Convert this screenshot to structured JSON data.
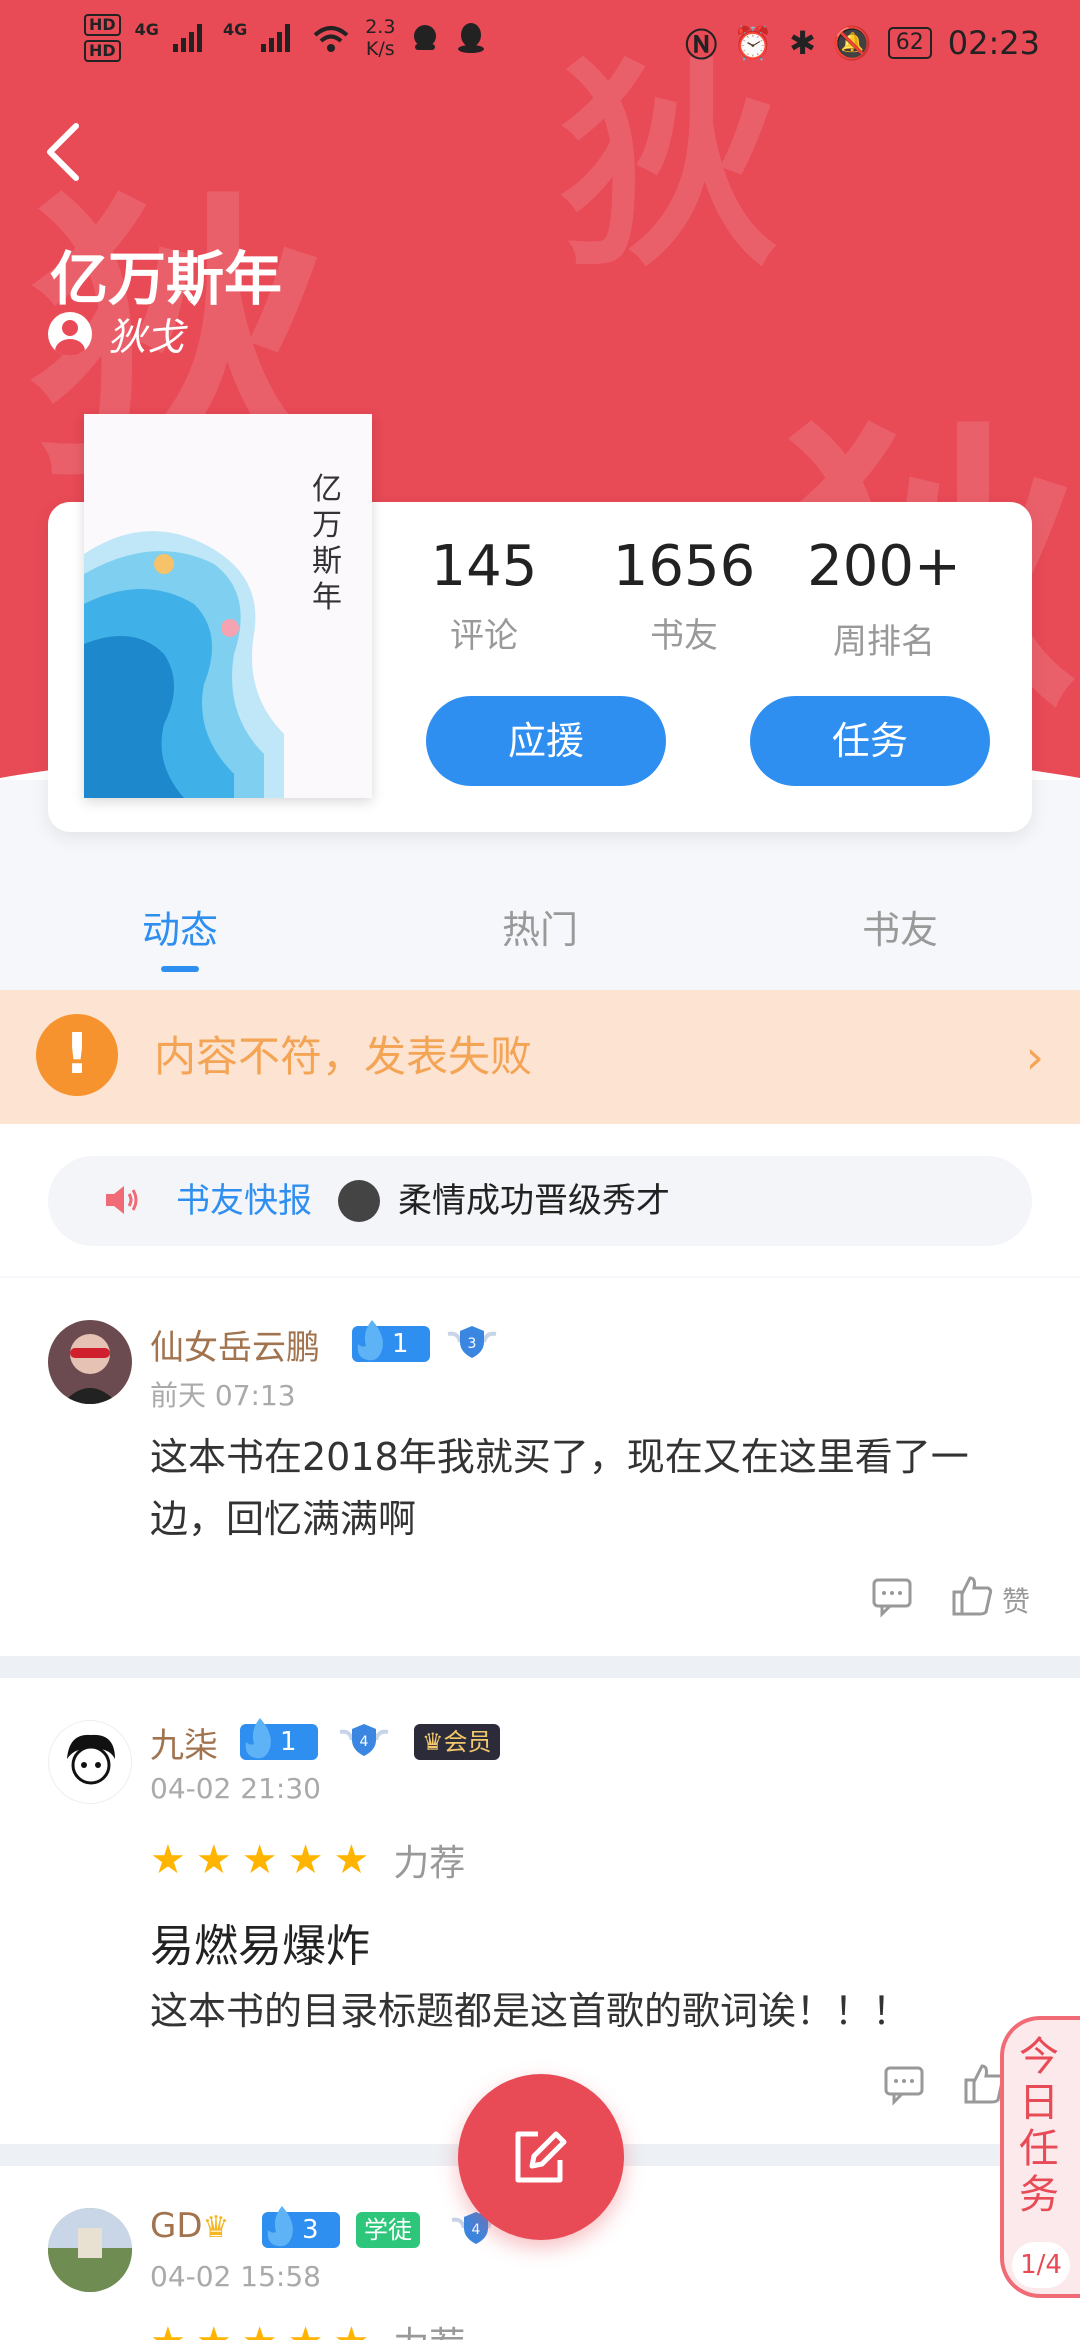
{
  "status_bar": {
    "hd1": "HD",
    "hd2": "HD",
    "signal1": "4G",
    "signal2": "4G",
    "net_speed_value": "2.3",
    "net_speed_unit": "K/s",
    "battery": "62",
    "time": "02:23"
  },
  "book": {
    "title": "亿万斯年",
    "author": "狄戈",
    "cover_title": "亿万斯年",
    "watermark_char": "狄"
  },
  "stats": [
    {
      "value": "145",
      "label": "评论"
    },
    {
      "value": "1656",
      "label": "书友"
    },
    {
      "value": "200+",
      "label": "周排名"
    }
  ],
  "buttons": {
    "support": "应援",
    "task": "任务"
  },
  "tabs": [
    {
      "label": "动态",
      "active": true
    },
    {
      "label": "热门",
      "active": false
    },
    {
      "label": "书友",
      "active": false
    }
  ],
  "warning": {
    "icon_text": "!",
    "text": "内容不符，发表失败"
  },
  "news": {
    "label": "书友快报",
    "text": "柔情成功晋级秀才"
  },
  "posts": [
    {
      "user": "仙女岳云鹏",
      "level": "1",
      "rank": "3",
      "time": "前天 07:13",
      "body": "这本书在2018年我就买了，现在又在这里看了一边，回忆满满啊",
      "like_label": "赞"
    },
    {
      "user": "九柒",
      "level": "1",
      "rank": "4",
      "member_badge": "会员",
      "time": "04-02 21:30",
      "rating": 5,
      "rating_label": "力荐",
      "title": "易燃易爆炸",
      "body": "这本书的目录标题都是这首歌的歌词诶！！！"
    },
    {
      "user": "GD",
      "level": "3",
      "apprentice_badge": "学徒",
      "rank": "4",
      "time": "04-02 15:58",
      "rating_label": "力荐"
    }
  ],
  "daily_task": {
    "label": "今日任务",
    "progress": "1/4"
  },
  "colors": {
    "brand_red": "#e84a56",
    "accent_blue": "#2f8ff0",
    "warning_orange": "#f7932f",
    "star_gold": "#ffb400"
  }
}
